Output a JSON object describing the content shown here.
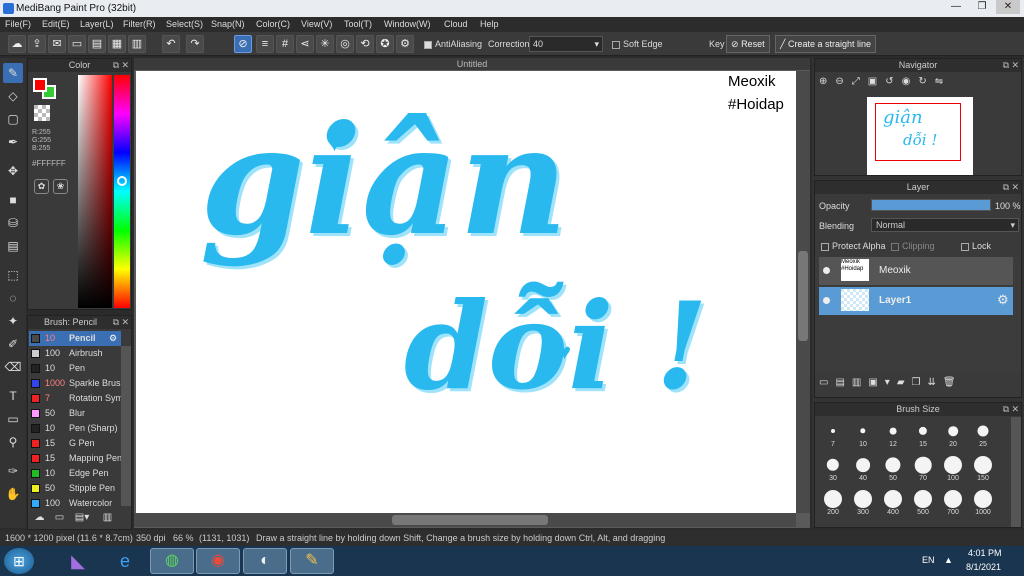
{
  "window": {
    "title": "MediBang Paint Pro (32bit)",
    "min": "—",
    "max": "❐",
    "close": "✕"
  },
  "menu": [
    "File(F)",
    "Edit(E)",
    "Layer(L)",
    "Filter(R)",
    "Select(S)",
    "Snap(N)",
    "Color(C)",
    "View(V)",
    "Tool(T)",
    "Window(W)",
    "Cloud",
    "Help"
  ],
  "toolbar": {
    "antialias_label": "AntiAliasing",
    "correction_label": "Correction",
    "correction_value": "40",
    "softedge_label": "Soft Edge",
    "key_label": "Key",
    "reset_label": "Reset",
    "straight_label": "Create a straight line"
  },
  "color": {
    "title": "Color",
    "r": "R:255",
    "g": "G:255",
    "b": "B:255",
    "hex": "#FFFFFF",
    "primary": "#ff0000",
    "secondary": "#33cc33"
  },
  "brush": {
    "title": "Brush: Pencil",
    "items": [
      {
        "size": "10",
        "name": "Pencil",
        "color": "#4a4a4a"
      },
      {
        "size": "100",
        "name": "Airbrush",
        "color": "#cccccc"
      },
      {
        "size": "10",
        "name": "Pen",
        "color": "#222222"
      },
      {
        "size": "1000",
        "name": "Sparkle Brush",
        "color": "#3344ee"
      },
      {
        "size": "7",
        "name": "Rotation Sym",
        "color": "#ee2222"
      },
      {
        "size": "50",
        "name": "Blur",
        "color": "#ff99ff"
      },
      {
        "size": "10",
        "name": "Pen (Sharp)",
        "color": "#222222"
      },
      {
        "size": "15",
        "name": "G Pen",
        "color": "#ee2222"
      },
      {
        "size": "15",
        "name": "Mapping Pen",
        "color": "#ee2222"
      },
      {
        "size": "10",
        "name": "Edge Pen",
        "color": "#22bb22"
      },
      {
        "size": "50",
        "name": "Stipple Pen",
        "color": "#eeee22"
      },
      {
        "size": "100",
        "name": "Watercolor",
        "color": "#33aaff"
      }
    ]
  },
  "document": {
    "tab": "Untitled",
    "watermark_line1": "Meoxik",
    "watermark_line2": "#Hoidap",
    "text_line1": "giận",
    "text_line2": "dỗi !",
    "ink": "#29b9ef"
  },
  "navigator": {
    "title": "Navigator"
  },
  "layer": {
    "title": "Layer",
    "opacity_label": "Opacity",
    "opacity_value": "100 %",
    "opacity_fraction": 1.0,
    "blending_label": "Blending",
    "blending_value": "Normal",
    "protect_alpha": "Protect Alpha",
    "clipping": "Clipping",
    "lock": "Lock",
    "layers": [
      {
        "name": "Meoxik",
        "thumb": "Meoxik #Hoidap"
      },
      {
        "name": "Layer1",
        "thumb": ""
      }
    ]
  },
  "brushsize": {
    "title": "Brush Size",
    "sizes": [
      "7",
      "10",
      "12",
      "15",
      "20",
      "25",
      "30",
      "40",
      "50",
      "70",
      "100",
      "150",
      "200",
      "300",
      "400",
      "500",
      "700",
      "1000"
    ]
  },
  "status": {
    "dims": "1600 * 1200 pixel",
    "physical": "(11.6 * 8.7cm)",
    "dpi": "350 dpi",
    "zoom": "66 %",
    "coords": "(1131, 1031)",
    "hint": "Draw a straight line by holding down Shift, Change a brush size by holding down Ctrl, Alt, and dragging"
  },
  "taskbar": {
    "lang": "EN",
    "time": "4:01 PM",
    "date": "8/1/2021"
  }
}
